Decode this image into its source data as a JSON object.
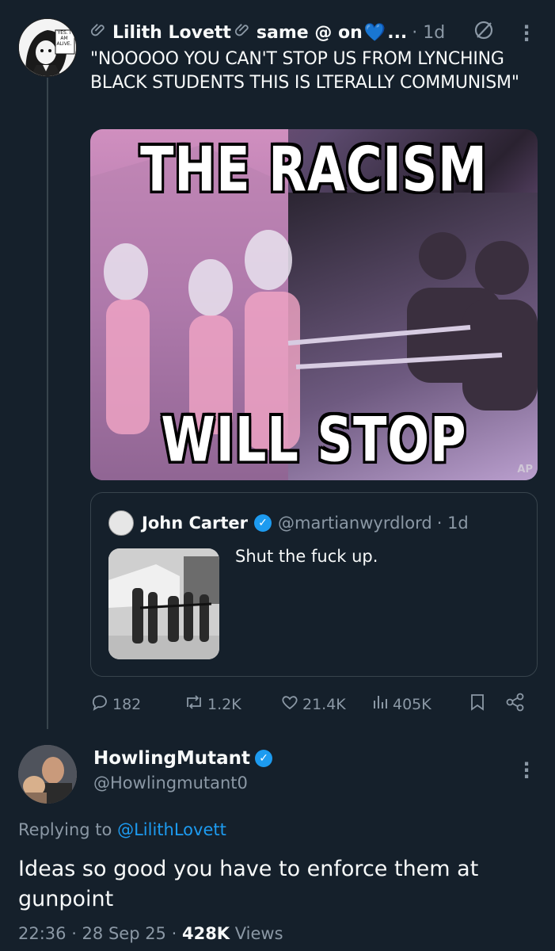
{
  "tweet": {
    "author_name": "Lilith Lovett",
    "author_suffix": "same @ on",
    "ellipsis": "...",
    "time": "· 1d",
    "text": "\"NOOOOO YOU CAN'T STOP US FROM LYNCHING BLACK STUDENTS THIS IS LTERALLY COMMUNISM\"",
    "avatar_text": "YES. I AM ALIVE.",
    "meme": {
      "top_text": "THE RACISM",
      "bottom_text": "WILL STOP",
      "watermark": "AP"
    },
    "stats": {
      "replies": "182",
      "reposts": "1.2K",
      "likes": "21.4K",
      "views": "405K"
    }
  },
  "quote": {
    "author_name": "John Carter",
    "handle": "@martianwyrdlord",
    "time": "· 1d",
    "text": "Shut the fuck up."
  },
  "reply": {
    "author_name": "HowlingMutant",
    "handle": "@Howlingmutant0",
    "replying_to_prefix": "Replying to",
    "replying_to_handle": "@LilithLovett",
    "text": "Ideas so good you have to enforce them at gunpoint",
    "timestamp": "22:36 · 28 Sep 25 ·",
    "views_count": "428K",
    "views_label": "Views"
  },
  "icons": {
    "clip": "paperclip-icon",
    "grok": "grok-icon",
    "more": "more-icon",
    "reply": "reply-icon",
    "repost": "repost-icon",
    "like": "heart-icon",
    "views": "views-icon",
    "bookmark": "bookmark-icon",
    "share": "share-icon"
  },
  "colors": {
    "background": "#15202b",
    "accent": "#1d9bf0",
    "muted": "#8b98a5"
  }
}
